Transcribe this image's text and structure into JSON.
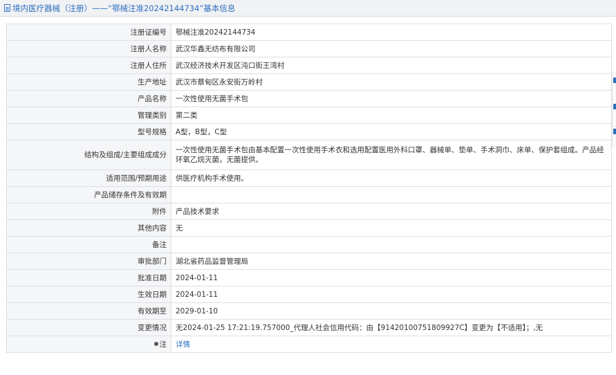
{
  "header": {
    "title": "境内医疗器械（注册）——“鄂械注准20242144734”基本信息"
  },
  "rows": [
    {
      "label": "注册证编号",
      "value": "鄂械注准20242144734"
    },
    {
      "label": "注册人名称",
      "value": "武汉华鑫无纺布有限公司"
    },
    {
      "label": "注册人住所",
      "value": "武汉经济技术开发区沌口街王湾村"
    },
    {
      "label": "生产地址",
      "value": "武汉市蔡甸区永安街万岭村"
    },
    {
      "label": "产品名称",
      "value": "一次性使用无菌手术包"
    },
    {
      "label": "管理类别",
      "value": "第二类"
    },
    {
      "label": "型号规格",
      "value": "A型，B型，C型"
    },
    {
      "label": "结构及组成/主要组成成分",
      "value": "一次性使用无菌手术包由基本配置一次性使用手术衣和选用配置医用外科口罩、器械单、垫单、手术洞巾、床单、保护套组成。产品经环氧乙烷灭菌，无菌提供。"
    },
    {
      "label": "适用范围/预期用途",
      "value": "供医疗机构手术使用。"
    },
    {
      "label": "产品储存条件及有效期",
      "value": ""
    },
    {
      "label": "附件",
      "value": "产品技术要求"
    },
    {
      "label": "其他内容",
      "value": "无"
    },
    {
      "label": "备注",
      "value": ""
    },
    {
      "label": "审批部门",
      "value": "湖北省药品监督管理局"
    },
    {
      "label": "批准日期",
      "value": "2024-01-11"
    },
    {
      "label": "生效日期",
      "value": "2024-01-11"
    },
    {
      "label": "有效期至",
      "value": "2029-01-10"
    },
    {
      "label": "变更情况",
      "value": "无2024-01-25 17:21:19.757000_代理人社会信用代码：由【91420100751809927C】变更为【不适用】；,无"
    }
  ],
  "remark": {
    "label": "注",
    "link": "详情"
  },
  "colors": {
    "accent": "#2f6fc0",
    "label_bg": "#f5f6f8",
    "border": "#dcdfe3"
  }
}
